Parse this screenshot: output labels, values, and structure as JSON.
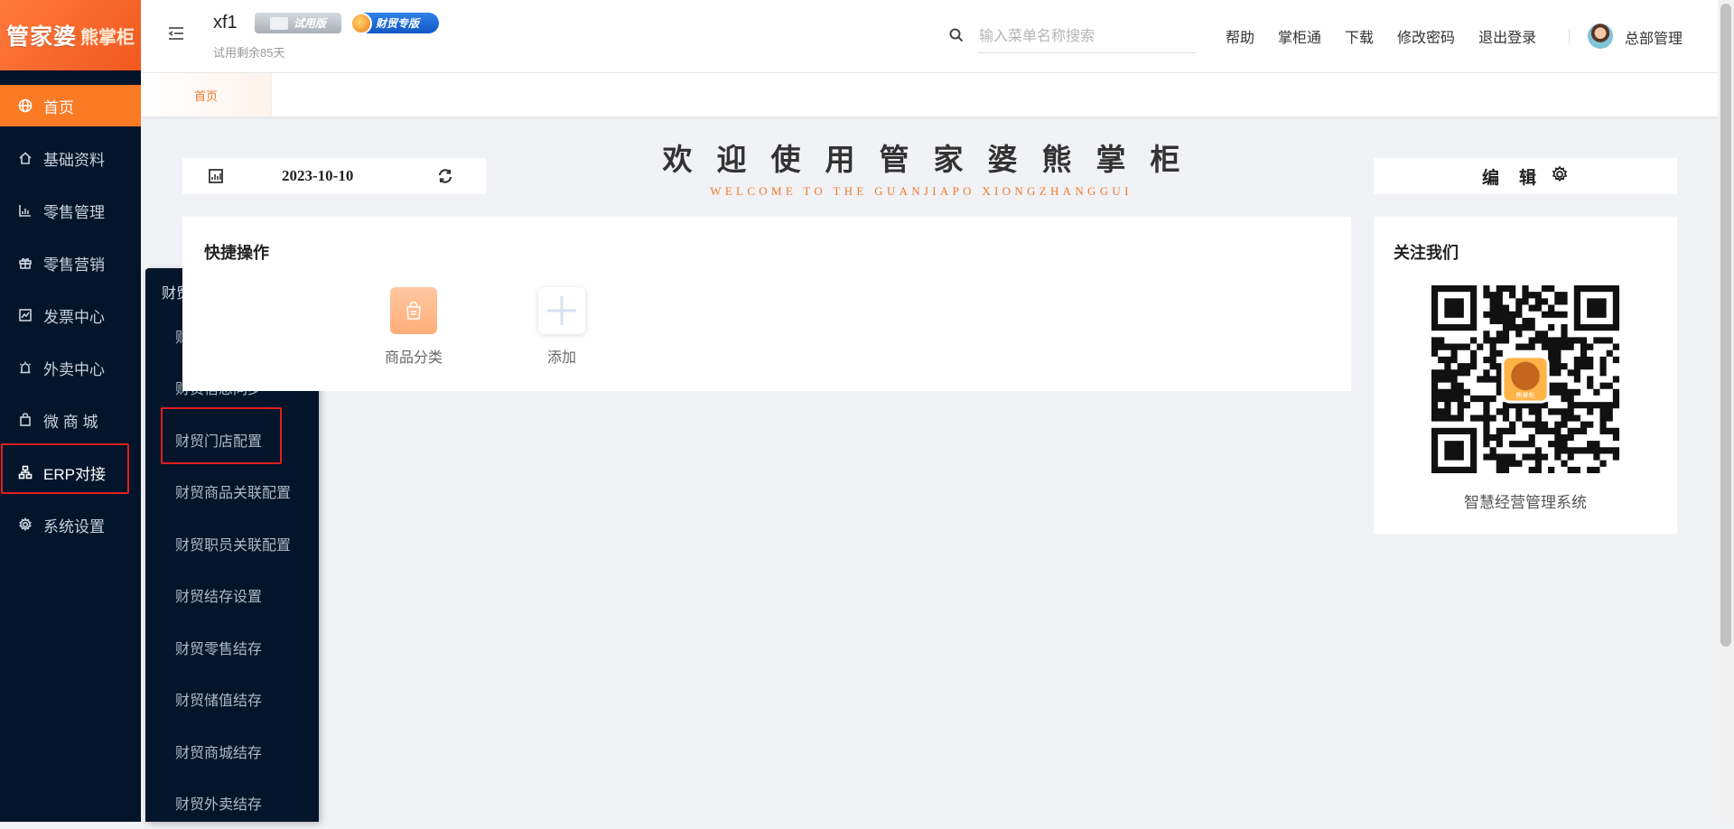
{
  "brand": {
    "name": "管家婆",
    "sub": "熊掌柜"
  },
  "sidebar": {
    "items": [
      {
        "label": "首页",
        "icon": "globe-icon",
        "active": true
      },
      {
        "label": "基础资料",
        "icon": "home-icon"
      },
      {
        "label": "零售管理",
        "icon": "bar-chart-icon"
      },
      {
        "label": "零售营销",
        "icon": "gift-icon"
      },
      {
        "label": "发票中心",
        "icon": "trend-chart-icon"
      },
      {
        "label": "外卖中心",
        "icon": "alarm-icon"
      },
      {
        "label": "微 商 城",
        "icon": "bag-icon"
      },
      {
        "label": "ERP对接",
        "icon": "sitemap-icon",
        "highlighted": true
      },
      {
        "label": "系统设置",
        "icon": "gear-icon"
      }
    ]
  },
  "flyout": {
    "title": "财贸信息设置",
    "items": [
      "财贸配置",
      "财贸信息同步",
      "财贸门店配置",
      "财贸商品关联配置",
      "财贸职员关联配置",
      "财贸结存设置",
      "财贸零售结存",
      "财贸储值结存",
      "财贸商城结存",
      "财贸外卖结存"
    ],
    "highlighted_index": 2
  },
  "header": {
    "company": "xf1",
    "trial_badge": "试用版",
    "pro_badge": "财贸专版",
    "trial_note": "试用剩余85天",
    "search_placeholder": "输入菜单名称搜索",
    "links": [
      "帮助",
      "掌柜通",
      "下载",
      "修改密码",
      "退出登录"
    ],
    "user": "总部管理"
  },
  "tabs": {
    "home": "首页"
  },
  "dashboard": {
    "date": "2023-10-10",
    "welcome_zh": "欢迎使用管家婆熊掌柜",
    "welcome_en": "WELCOME TO THE GUANJIAPO XIONGZHANGGUI",
    "edit_label": "编辑",
    "quick_title": "快捷操作",
    "quick_actions": [
      {
        "label": "商品分类",
        "icon": "shopping-bag-icon"
      },
      {
        "label": "添加",
        "icon": "plus-icon"
      }
    ],
    "follow_title": "关注我们",
    "qr_caption": "智慧经营管理系统",
    "qr_logo_text": "熊掌柜"
  },
  "colors": {
    "accent": "#fb7a24",
    "sidebar_bg": "#04152b",
    "highlight_outline": "#e0201c"
  }
}
